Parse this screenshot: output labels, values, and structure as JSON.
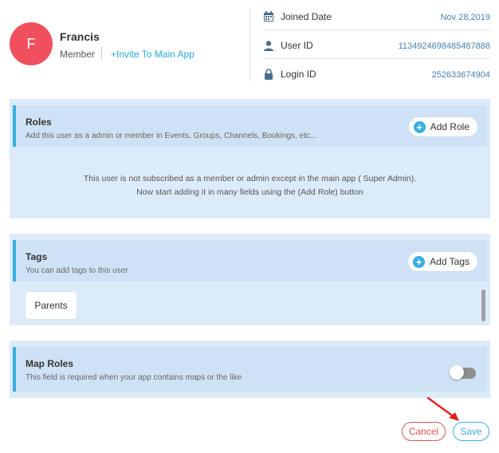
{
  "user": {
    "avatar_letter": "F",
    "name": "Francis",
    "role": "Member",
    "invite_label": "+Invite To Main App"
  },
  "info": [
    {
      "icon": "calendar-icon",
      "label": "Joined Date",
      "value": "Nov 28,2019"
    },
    {
      "icon": "user-icon",
      "label": "User ID",
      "value": "1134924698485487888"
    },
    {
      "icon": "lock-icon",
      "label": "Login ID",
      "value": "252633674904"
    }
  ],
  "roles": {
    "title": "Roles",
    "subtitle": "Add this user as a admin or member in Events, Groups, Channels, Bookings, etc...",
    "add_label": "Add Role",
    "empty_line1": "This user is not subscribed as a member or admin except in the main app ( Super Admin).",
    "empty_line2": "Now start adding it in many fields using the (Add Role) button"
  },
  "tags": {
    "title": "Tags",
    "subtitle": "You can add tags to this user",
    "add_label": "Add Tags",
    "items": [
      "Parents"
    ]
  },
  "map_roles": {
    "title": "Map Roles",
    "subtitle": "This field is required when your app contains maps or the like",
    "enabled": false
  },
  "actions": {
    "cancel_label": "Cancel",
    "save_label": "Save"
  },
  "colors": {
    "avatar": "#f0505e",
    "accent": "#3aaee0",
    "panel_bg": "#dcebf9",
    "cancel": "#d9534f",
    "arrow": "#e02020"
  }
}
